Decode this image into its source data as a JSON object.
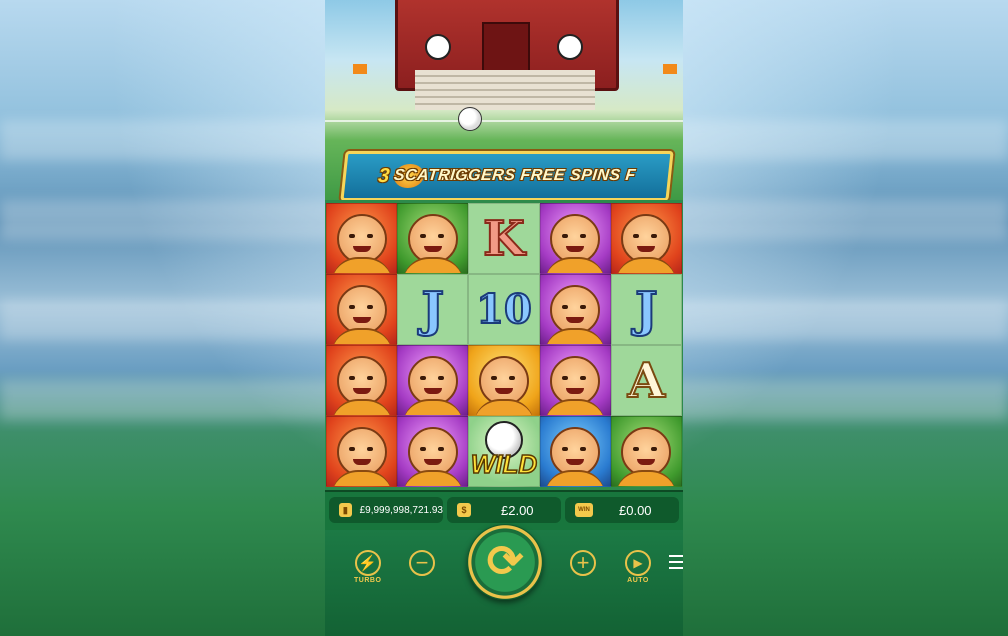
{
  "banner": {
    "number": "3",
    "scatter_label": "SCATTER",
    "text": "TRIGGERS FREE SPINS F"
  },
  "reels": [
    [
      {
        "symbol": "monk-angry",
        "bg": "red"
      },
      {
        "symbol": "monk-happy",
        "bg": "green"
      },
      {
        "symbol": "K",
        "bg": "plain"
      },
      {
        "symbol": "monk-laugh",
        "bg": "purple"
      },
      {
        "symbol": "monk-angry",
        "bg": "red"
      }
    ],
    [
      {
        "symbol": "monk-angry",
        "bg": "red"
      },
      {
        "symbol": "J",
        "bg": "plain"
      },
      {
        "symbol": "10",
        "bg": "plain"
      },
      {
        "symbol": "monk-laugh",
        "bg": "purple"
      },
      {
        "symbol": "J",
        "bg": "plain"
      }
    ],
    [
      {
        "symbol": "monk-angry",
        "bg": "red"
      },
      {
        "symbol": "monk-laugh",
        "bg": "purple"
      },
      {
        "symbol": "kicker",
        "bg": "gold"
      },
      {
        "symbol": "monk-laugh",
        "bg": "purple"
      },
      {
        "symbol": "A",
        "bg": "plain"
      }
    ],
    [
      {
        "symbol": "monk-angry",
        "bg": "red"
      },
      {
        "symbol": "monk-laugh",
        "bg": "purple"
      },
      {
        "symbol": "WILD",
        "bg": "wild"
      },
      {
        "symbol": "monk-shout",
        "bg": "blue"
      },
      {
        "symbol": "monk-happy",
        "bg": "green"
      }
    ]
  ],
  "info": {
    "balance": "£9,999,998,721.93",
    "bet": "£2.00",
    "win": "£0.00",
    "win_icon": "WIN"
  },
  "controls": {
    "turbo_label": "TURBO",
    "auto_label": "AUTO"
  },
  "colors": {
    "accent_gold": "#e9c24a",
    "bar_green": "#18763d"
  }
}
